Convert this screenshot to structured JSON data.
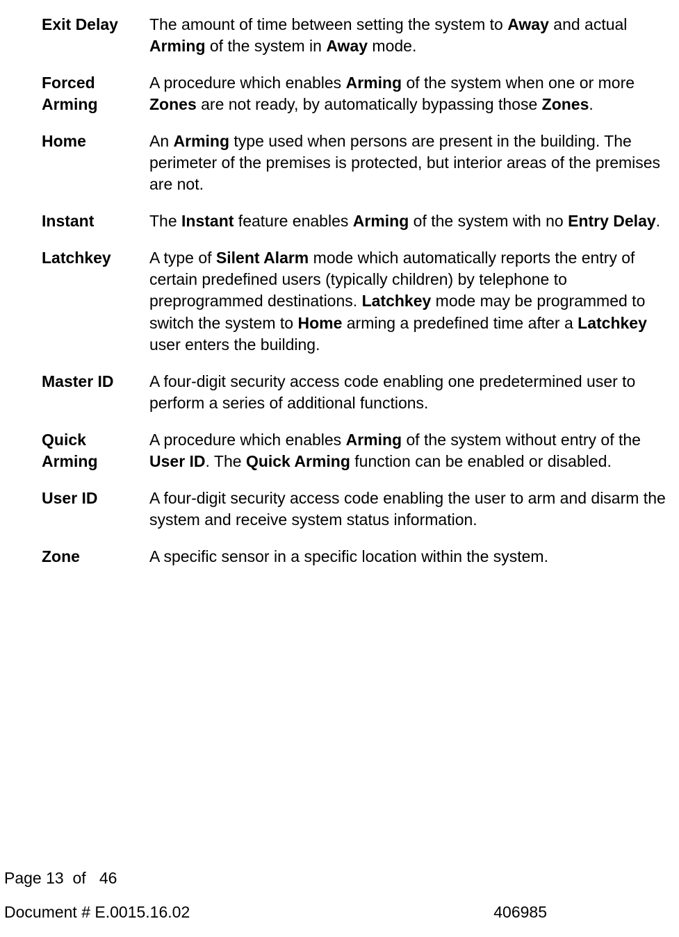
{
  "entries": [
    {
      "term": "Exit Delay",
      "def": "The amount of time between setting the system to <b>Away</b> and actual <b>Arming</b> of the system in <b>Away</b> mode."
    },
    {
      "term": "Forced Arming",
      "def": "A procedure which enables <b>Arming</b> of the system when one or more <b>Zones</b> are not ready, by automatically bypassing those <b>Zones</b>."
    },
    {
      "term": "Home",
      "def": "An <b>Arming</b> type used when persons are present in the building. The perimeter of the premises is protected, but interior areas of the premises are not."
    },
    {
      "term": "Instant",
      "def": "The <b>Instant</b> feature enables <b>Arming</b> of the system with no <b>Entry Delay</b>."
    },
    {
      "term": "Latchkey",
      "def": "A type of <b>Silent Alarm</b> mode which automatically reports the entry of certain predefined users (typically children) by telephone to preprogrammed destinations. <b>Latchkey</b> mode may be programmed to switch the system to <b>Home</b> arming a predefined time after a <b>Latchkey</b> user enters the building."
    },
    {
      "term": "Master ID",
      "def": "A four-digit security access code enabling one predetermined user to perform a series of additional functions."
    },
    {
      "term": "Quick Arming",
      "def": "A procedure which enables <b>Arming</b> of the system without entry of the <b>User ID</b>. The <b>Quick Arming</b> function can be enabled or disabled."
    },
    {
      "term": "User ID",
      "def": "A four-digit security access code enabling the user to arm and disarm the system and receive system status information."
    },
    {
      "term": "Zone",
      "def": "A specific sensor in a specific location within the system."
    }
  ],
  "footer": {
    "page_label": "Page",
    "page_current": "13",
    "page_of": "of",
    "page_total": "46",
    "doc_label": "Document # E.0015.16.02",
    "doc_code": "406985"
  }
}
